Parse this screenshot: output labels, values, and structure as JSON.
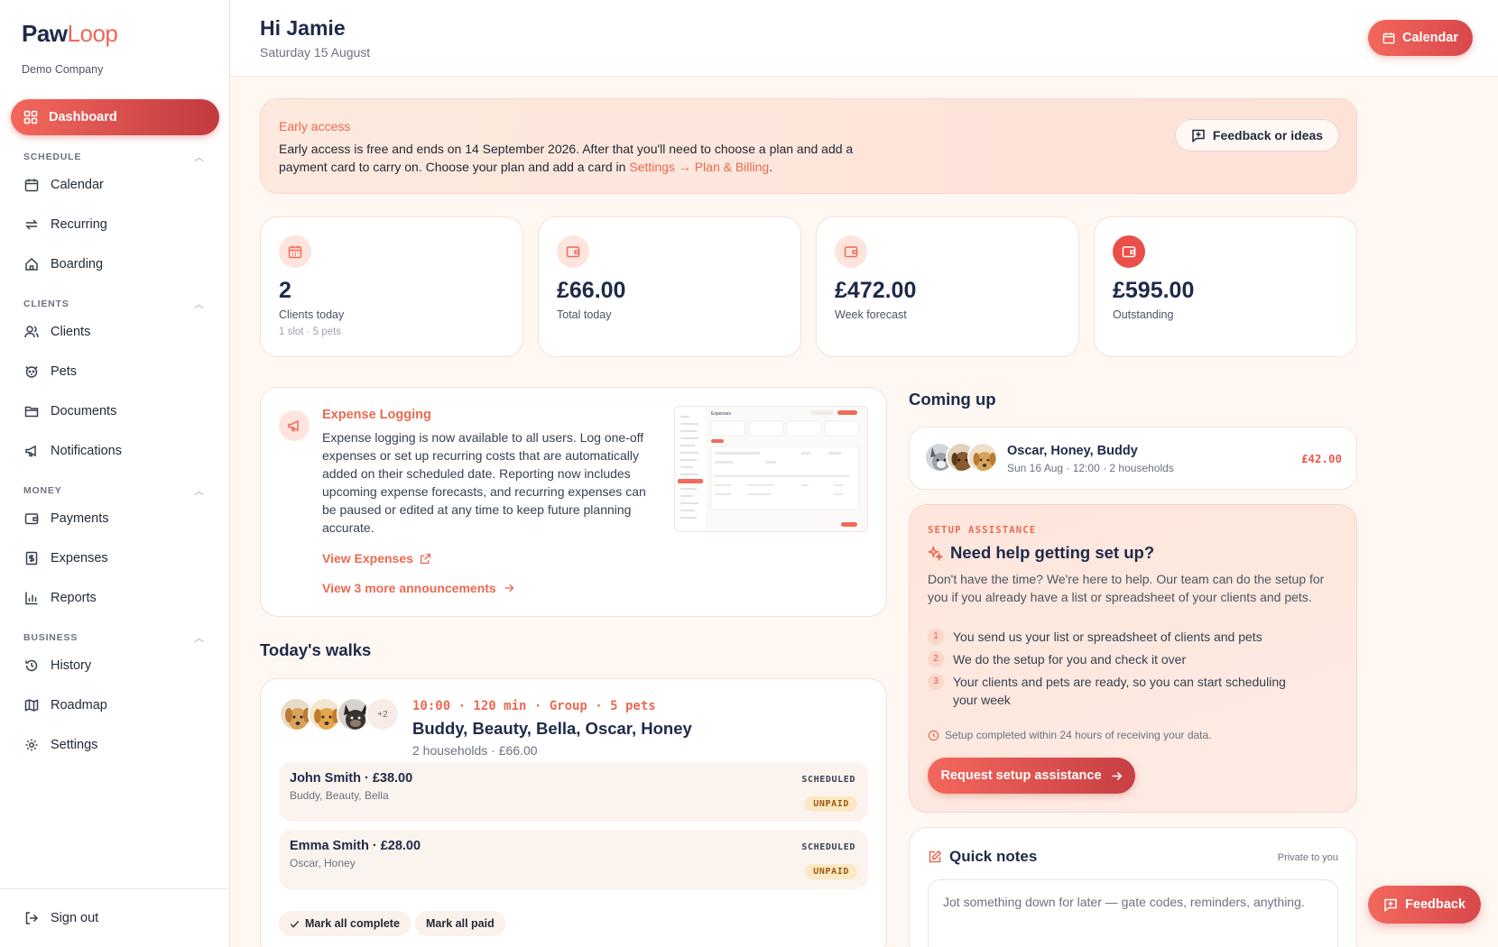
{
  "brand": {
    "logo_main": "Paw",
    "logo_accent": "Loop",
    "company": "Demo Company",
    "accent": "#f0665a"
  },
  "header": {
    "greeting": "Hi Jamie",
    "date": "Saturday 15 August",
    "calendar_button": "Calendar"
  },
  "sidebar": {
    "active": {
      "label": "Dashboard",
      "icon": "grid-icon"
    },
    "sections": [
      {
        "label": "SCHEDULE",
        "items": [
          {
            "label": "Calendar",
            "icon": "calendar-icon"
          },
          {
            "label": "Recurring",
            "icon": "repeat-icon"
          },
          {
            "label": "Boarding",
            "icon": "home-icon"
          }
        ]
      },
      {
        "label": "CLIENTS",
        "items": [
          {
            "label": "Clients",
            "icon": "users-icon"
          },
          {
            "label": "Pets",
            "icon": "paw-icon"
          },
          {
            "label": "Documents",
            "icon": "folder-icon"
          },
          {
            "label": "Notifications",
            "icon": "megaphone-icon"
          }
        ]
      },
      {
        "label": "MONEY",
        "items": [
          {
            "label": "Payments",
            "icon": "wallet-icon"
          },
          {
            "label": "Expenses",
            "icon": "receipt-icon"
          },
          {
            "label": "Reports",
            "icon": "bar-chart-icon"
          }
        ]
      },
      {
        "label": "BUSINESS",
        "items": [
          {
            "label": "History",
            "icon": "history-icon"
          },
          {
            "label": "Roadmap",
            "icon": "map-icon"
          },
          {
            "label": "Settings",
            "icon": "gear-icon"
          }
        ]
      }
    ],
    "sign_out": "Sign out"
  },
  "banner": {
    "title": "Early access",
    "text_before": "Early access is free and ends on 14 September 2026. After that you'll need to choose a plan and add a payment card to carry on. Choose your plan and add a card in ",
    "link": "Settings → Plan & Billing",
    "text_after": ".",
    "feedback_button": "Feedback or ideas"
  },
  "stats": [
    {
      "value": "2",
      "label": "Clients today",
      "sub": "1 slot · 5 pets",
      "icon": "calendar-icon"
    },
    {
      "value": "£66.00",
      "label": "Total today",
      "sub": "",
      "icon": "wallet-icon"
    },
    {
      "value": "£472.00",
      "label": "Week forecast",
      "sub": "",
      "icon": "wallet-icon"
    },
    {
      "value": "£595.00",
      "label": "Outstanding",
      "sub": "",
      "icon": "wallet-icon"
    }
  ],
  "announcement": {
    "title": "Expense Logging",
    "text": "Expense logging is now available to all users. Log one-off expenses or set up recurring costs that are automatically added on their scheduled date. Reporting now includes upcoming expense forecasts, and recurring expenses can be paused or edited at any time to keep future planning accurate.",
    "link_primary": "View Expenses",
    "link_more": "View 3 more announcements",
    "thumb_title": "Expenses"
  },
  "walks": {
    "title": "Today's walks",
    "more_count": "+2",
    "meta": "10:00 · 120 min · Group · 5 pets",
    "names": "Buddy, Beauty, Bella, Oscar, Honey",
    "sub": "2 households · £66.00",
    "bookings": [
      {
        "name": "John Smith · £38.00",
        "pets": "Buddy, Beauty, Bella",
        "status": "SCHEDULED",
        "payment": "UNPAID"
      },
      {
        "name": "Emma Smith · £28.00",
        "pets": "Oscar, Honey",
        "status": "SCHEDULED",
        "payment": "UNPAID"
      }
    ],
    "mark_complete": "Mark all complete",
    "mark_paid": "Mark all paid"
  },
  "coming_up": {
    "title": "Coming up",
    "names": "Oscar, Honey, Buddy",
    "meta": "Sun 16 Aug · 12:00 · 2 households",
    "amount": "£42.00"
  },
  "setup": {
    "tag": "SETUP ASSISTANCE",
    "title": "Need help getting set up?",
    "desc": "Don't have the time? We're here to help. Our team can do the setup for you if you already have a list or spreadsheet of your clients and pets.",
    "steps": [
      {
        "num": "1",
        "text": "You send us your list or spreadsheet of clients and pets"
      },
      {
        "num": "2",
        "text": "We do the setup for you and check it over"
      },
      {
        "num": "3",
        "text": "Your clients and pets are ready, so you can start scheduling your week"
      }
    ],
    "note": "Setup completed within 24 hours of receiving your data.",
    "button": "Request setup assistance"
  },
  "notes": {
    "title": "Quick notes",
    "private": "Private to you",
    "placeholder": "Jot something down for later — gate codes, reminders, anything."
  },
  "fab": {
    "label": "Feedback"
  }
}
